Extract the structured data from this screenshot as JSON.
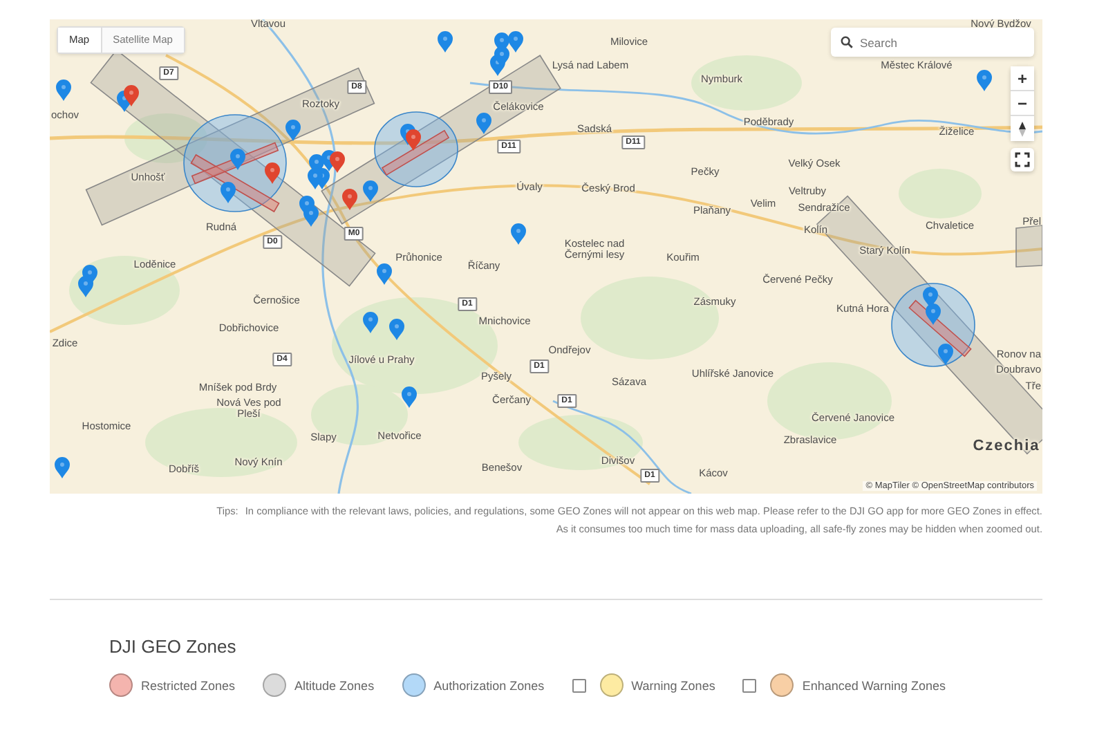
{
  "map": {
    "tabs": [
      {
        "label": "Map",
        "selected": true
      },
      {
        "label": "Satellite Map",
        "selected": false
      }
    ],
    "search": {
      "placeholder": "Search"
    },
    "zoom_controls": [
      "+",
      "−"
    ],
    "attribution": "© MapTiler © OpenStreetMap contributors",
    "places": [
      {
        "name": "Vltavou"
      },
      {
        "name": "Milovice"
      },
      {
        "name": "Nový Bydžov"
      },
      {
        "name": "Lysá nad Labem"
      },
      {
        "name": "Městec Králové"
      },
      {
        "name": "Roztoky"
      },
      {
        "name": "Čelákovice"
      },
      {
        "name": "Nymburk"
      },
      {
        "name": "Sadská"
      },
      {
        "name": "Poděbrady"
      },
      {
        "name": "Žiželice"
      },
      {
        "name": "ochov"
      },
      {
        "name": "Unhošť"
      },
      {
        "name": "Úvaly"
      },
      {
        "name": "Český Brod"
      },
      {
        "name": "Pečky"
      },
      {
        "name": "Velký Osek"
      },
      {
        "name": "Veltruby"
      },
      {
        "name": "Velim"
      },
      {
        "name": "Plaňany"
      },
      {
        "name": "Sendražice"
      },
      {
        "name": "Kolín"
      },
      {
        "name": "Chvaletice"
      },
      {
        "name": "Přel"
      },
      {
        "name": "Starý Kolín"
      },
      {
        "name": "Rudná"
      },
      {
        "name": "Průhonice"
      },
      {
        "name": "Říčany"
      },
      {
        "name": "Kostelec nad Černými lesy"
      },
      {
        "name": "Kouřim"
      },
      {
        "name": "Loděnice"
      },
      {
        "name": "Černošice"
      },
      {
        "name": "Dobřichovice"
      },
      {
        "name": "Zdice"
      },
      {
        "name": "Mnichovice"
      },
      {
        "name": "Zásmuky"
      },
      {
        "name": "Červené Pečky"
      },
      {
        "name": "Kutná Hora"
      },
      {
        "name": "Ondřejov"
      },
      {
        "name": "Jílové u Prahy"
      },
      {
        "name": "Mníšek pod Brdy"
      },
      {
        "name": "Pyšely"
      },
      {
        "name": "Nová Ves pod Pleší"
      },
      {
        "name": "Sázava"
      },
      {
        "name": "Uhlířské Janovice"
      },
      {
        "name": "Ronov na"
      },
      {
        "name": "Doubravo"
      },
      {
        "name": "Tře"
      },
      {
        "name": "Čerčany"
      },
      {
        "name": "Hostomice"
      },
      {
        "name": "Slapy"
      },
      {
        "name": "Netvořice"
      },
      {
        "name": "Červené Janovice"
      },
      {
        "name": "Zbraslavice"
      },
      {
        "name": "Dobříš"
      },
      {
        "name": "Nový Knín"
      },
      {
        "name": "Benešov"
      },
      {
        "name": "Divišov"
      },
      {
        "name": "Kácov"
      },
      {
        "name": "Czechia",
        "kind": "country"
      }
    ],
    "road_signs": [
      "D7",
      "D8",
      "D10",
      "D11",
      "D11",
      "D0",
      "M0",
      "D1",
      "D4",
      "D1",
      "D1",
      "D1"
    ],
    "markers": [
      {
        "color": "#1e88e5"
      },
      {
        "color": "#1e88e5"
      },
      {
        "color": "#1e88e5"
      },
      {
        "color": "#1e88e5"
      },
      {
        "color": "#1e88e5"
      },
      {
        "color": "#1e88e5"
      },
      {
        "color": "#1e88e5"
      },
      {
        "color": "#1e88e5"
      },
      {
        "color": "#1e88e5"
      },
      {
        "color": "#1e88e5"
      },
      {
        "color": "#1e88e5"
      },
      {
        "color": "#1e88e5"
      },
      {
        "color": "#1e88e5"
      },
      {
        "color": "#1e88e5"
      },
      {
        "color": "#1e88e5"
      },
      {
        "color": "#1e88e5"
      },
      {
        "color": "#1e88e5"
      },
      {
        "color": "#1e88e5"
      },
      {
        "color": "#1e88e5"
      },
      {
        "color": "#1e88e5"
      },
      {
        "color": "#1e88e5"
      },
      {
        "color": "#1e88e5"
      },
      {
        "color": "#1e88e5"
      },
      {
        "color": "#1e88e5"
      },
      {
        "color": "#1e88e5"
      },
      {
        "color": "#1e88e5"
      },
      {
        "color": "#1e88e5"
      },
      {
        "color": "#1e88e5"
      },
      {
        "color": "#1e88e5"
      },
      {
        "color": "#1e88e5"
      },
      {
        "color": "#1e88e5"
      },
      {
        "color": "#e0452f"
      },
      {
        "color": "#e0452f"
      },
      {
        "color": "#e0452f"
      },
      {
        "color": "#e0452f"
      },
      {
        "color": "#e0452f"
      }
    ]
  },
  "tips": {
    "label": "Tips:",
    "lines": [
      "In compliance with the relevant laws, policies, and regulations, some GEO Zones will not appear on this web map. Please refer to the DJI GO app for more GEO Zones in effect.",
      "As it consumes too much time for mass data uploading, all safe-fly zones may be hidden when zoomed out."
    ]
  },
  "legend": {
    "title": "DJI GEO Zones",
    "items": [
      {
        "label": "Restricted Zones",
        "color": "#f4b4ae",
        "kind": "plain"
      },
      {
        "label": "Altitude Zones",
        "color": "#dcdcdc",
        "kind": "plain"
      },
      {
        "label": "Authorization Zones",
        "color": "#b3d9f8",
        "kind": "plain"
      },
      {
        "label": "Warning Zones",
        "color": "#fdeba2",
        "kind": "toggle",
        "checked": false
      },
      {
        "label": "Enhanced Warning Zones",
        "color": "#f8cfa5",
        "kind": "toggle",
        "checked": false
      }
    ]
  }
}
